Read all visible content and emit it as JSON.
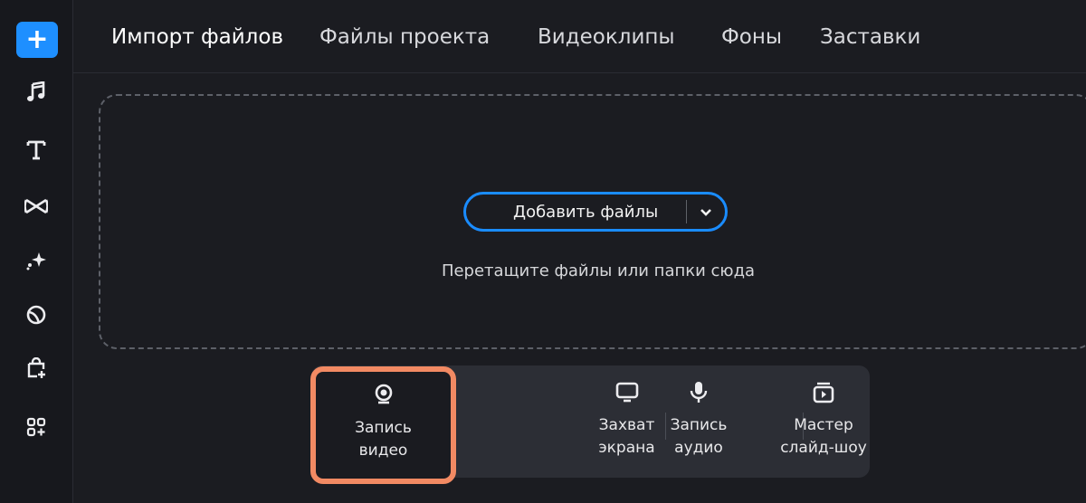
{
  "sidebar": {
    "add_button": "+",
    "icons": [
      "music-icon",
      "text-icon",
      "transitions-icon",
      "effects-icon",
      "stickers-icon",
      "store-icon",
      "more-icon"
    ]
  },
  "tabs": [
    {
      "label": "Импорт файлов",
      "active": true
    },
    {
      "label": "Файлы проекта",
      "active": false
    },
    {
      "label": "Видеоклипы",
      "active": false
    },
    {
      "label": "Фоны",
      "active": false
    },
    {
      "label": "Заставки",
      "active": false
    }
  ],
  "dropzone": {
    "add_files_label": "Добавить файлы",
    "hint": "Перетащите файлы или папки сюда"
  },
  "capture": {
    "items": [
      {
        "line1": "Запись",
        "line2": "видео",
        "icon": "webcam-icon"
      },
      {
        "line1": "Захват",
        "line2": "экрана",
        "icon": "monitor-icon"
      },
      {
        "line1": "Запись",
        "line2": "аудио",
        "icon": "microphone-icon"
      },
      {
        "line1": "Мастер",
        "line2": "слайд-шоу",
        "icon": "slideshow-icon"
      }
    ]
  },
  "colors": {
    "accent": "#1a8cff",
    "highlight": "#f28a63",
    "background": "#1b1c21",
    "sidebar": "#17181d"
  }
}
